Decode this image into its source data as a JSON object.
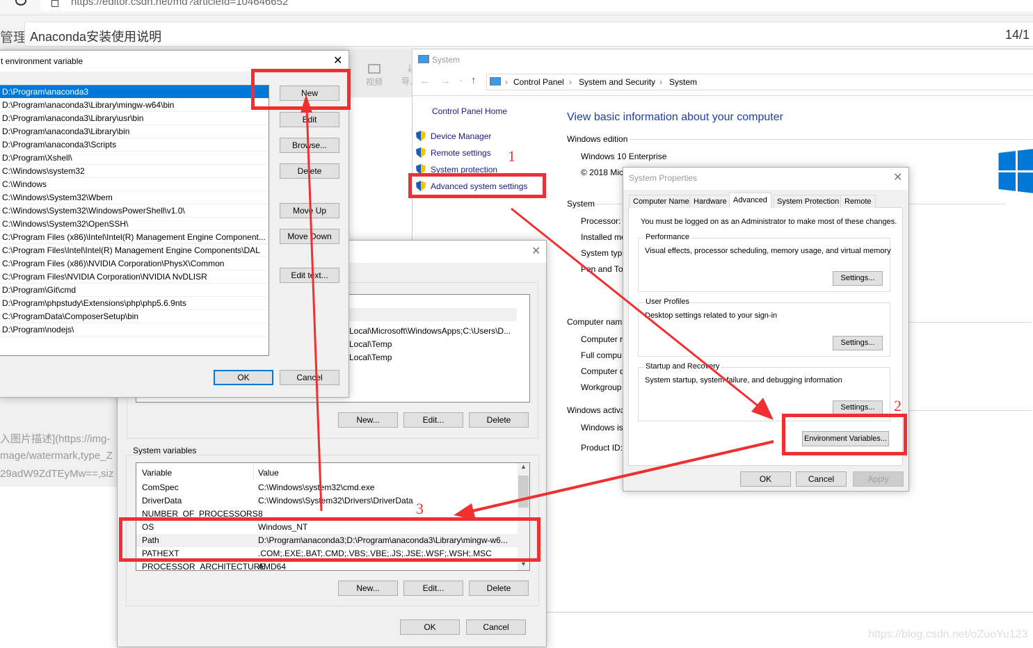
{
  "browser": {
    "url": "https://editor.csdn.net/md?articleId=104646652",
    "left_label": "管理",
    "article_title": "Anaconda安装使用说明",
    "title_count": "14/1",
    "toolbar": [
      {
        "label": "视频",
        "icon": "video-icon"
      },
      {
        "label": "导入",
        "icon": "import-icon"
      }
    ],
    "editor_lines": [
      "入图片描述](https://img-",
      "mage/watermark,type_Z",
      "29adW9ZdTEyMw==,siz"
    ],
    "watermark": "https://blog.csdn.net/oZuoYu123"
  },
  "system_window": {
    "title": "System",
    "breadcrumb": [
      "Control Panel",
      "System and Security",
      "System"
    ],
    "nav_home": "Control Panel Home",
    "nav_items": [
      "Device Manager",
      "Remote settings",
      "System protection",
      "Advanced system settings"
    ],
    "heading": "View basic information about your computer",
    "sections": [
      {
        "title": "Windows edition",
        "lines": [
          "Windows 10 Enterprise",
          "© 2018 Mic"
        ]
      },
      {
        "title": "System",
        "lines": [
          "Processor:",
          "Installed me",
          "System type",
          "Pen and To"
        ]
      },
      {
        "title": "Computer nam",
        "lines": [
          "Computer r",
          "Full compu",
          "Computer d",
          "Workgroup"
        ]
      },
      {
        "title": "Windows activa",
        "lines": [
          "Windows is",
          "Product ID:"
        ]
      }
    ],
    "heading_color": "#1e3ea8",
    "logo_color": "#0078d7"
  },
  "system_properties": {
    "title": "System Properties",
    "tabs": [
      "Computer Name",
      "Hardware",
      "Advanced",
      "System Protection",
      "Remote"
    ],
    "active_tab": "Advanced",
    "admin_note": "You must be logged on as an Administrator to make most of these changes.",
    "groups": [
      {
        "title": "Performance",
        "desc": "Visual effects, processor scheduling, memory usage, and virtual memory",
        "button": "Settings..."
      },
      {
        "title": "User Profiles",
        "desc": "Desktop settings related to your sign-in",
        "button": "Settings..."
      },
      {
        "title": "Startup and Recovery",
        "desc": "System startup, system failure, and debugging information",
        "button": "Settings..."
      }
    ],
    "env_button": "Environment Variables...",
    "ok": "OK",
    "cancel": "Cancel",
    "apply": "Apply"
  },
  "env_dialog": {
    "user_rows": [
      "Local\\Microsoft\\WindowsApps;C:\\Users\\D...",
      "Local\\Temp",
      "Local\\Temp"
    ],
    "user_buttons": [
      "New...",
      "Edit...",
      "Delete"
    ],
    "system_label": "System variables",
    "columns": [
      "Variable",
      "Value"
    ],
    "system_rows": [
      [
        "ComSpec",
        "C:\\Windows\\system32\\cmd.exe"
      ],
      [
        "DriverData",
        "C:\\Windows\\System32\\Drivers\\DriverData"
      ],
      [
        "NUMBER_OF_PROCESSORS",
        "8"
      ],
      [
        "OS",
        "Windows_NT"
      ],
      [
        "Path",
        "D:\\Program\\anaconda3;D:\\Program\\anaconda3\\Library\\mingw-w6..."
      ],
      [
        "PATHEXT",
        ".COM;.EXE;.BAT;.CMD;.VBS;.VBE;.JS;.JSE;.WSF;.WSH;.MSC"
      ],
      [
        "PROCESSOR_ARCHITECTURE",
        "AMD64"
      ]
    ],
    "system_buttons": [
      "New...",
      "Edit...",
      "Delete"
    ],
    "ok": "OK",
    "cancel": "Cancel"
  },
  "edit_dialog": {
    "title": "t environment variable",
    "paths": [
      "D:\\Program\\anaconda3",
      "D:\\Program\\anaconda3\\Library\\mingw-w64\\bin",
      "D:\\Program\\anaconda3\\Library\\usr\\bin",
      "D:\\Program\\anaconda3\\Library\\bin",
      "D:\\Program\\anaconda3\\Scripts",
      "D:\\Program\\Xshell\\",
      "C:\\Windows\\system32",
      "C:\\Windows",
      "C:\\Windows\\System32\\Wbem",
      "C:\\Windows\\System32\\WindowsPowerShell\\v1.0\\",
      "C:\\Windows\\System32\\OpenSSH\\",
      "C:\\Program Files (x86)\\Intel\\Intel(R) Management Engine Component...",
      "C:\\Program Files\\Intel\\Intel(R) Management Engine Components\\DAL",
      "C:\\Program Files (x86)\\NVIDIA Corporation\\PhysX\\Common",
      "C:\\Program Files\\NVIDIA Corporation\\NVIDIA NvDLISR",
      "D:\\Program\\Git\\cmd",
      "D:\\Program\\phpstudy\\Extensions\\php\\php5.6.9nts",
      "C:\\ProgramData\\ComposerSetup\\bin",
      "D:\\Program\\nodejs\\"
    ],
    "buttons": [
      "New",
      "Edit",
      "Browse...",
      "Delete",
      "Move Up",
      "Move Down",
      "Edit text..."
    ],
    "ok": "OK",
    "cancel": "Cancel"
  },
  "annotations": {
    "steps": [
      "1",
      "2",
      "3"
    ],
    "color": "#f03030"
  }
}
